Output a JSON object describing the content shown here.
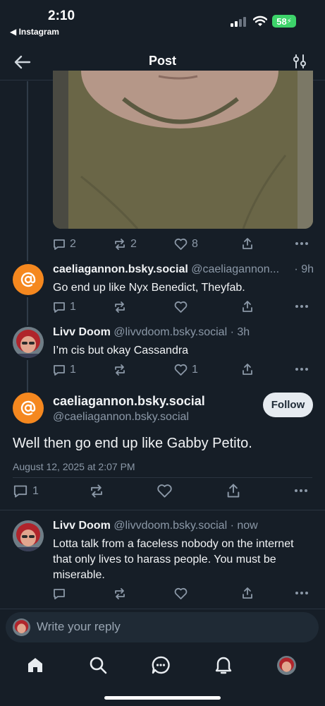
{
  "status": {
    "time": "2:10",
    "back_app": "◀ Instagram",
    "battery": "58"
  },
  "header": {
    "title": "Post"
  },
  "first_post": {
    "actions": {
      "replies": "2",
      "reposts": "2",
      "likes": "8"
    }
  },
  "reply1": {
    "name": "caeliagannon.bsky.social",
    "handle": "@caeliagannon...",
    "time": "· 9h",
    "text": "Go end up like Nyx Benedict, Theyfab.",
    "actions": {
      "replies": "1"
    }
  },
  "reply2": {
    "name": "Livv Doom",
    "handle": "@livvdoom.bsky.social",
    "time": "· 3h",
    "text": "I’m cis but okay Cassandra",
    "actions": {
      "replies": "1",
      "likes": "1"
    }
  },
  "main_post": {
    "name": "caeliagannon.bsky.social",
    "handle": "@caeliagannon.bsky.social",
    "follow_label": "Follow",
    "text": "Well then go end up like Gabby Petito.",
    "timestamp": "August 12, 2025 at 2:07 PM",
    "actions": {
      "replies": "1"
    }
  },
  "reply3": {
    "name": "Livv Doom",
    "handle": "@livvdoom.bsky.social",
    "time": "· now",
    "text": "Lotta talk from a faceless nobody on the internet that only lives to harass people. You must be miserable."
  },
  "composer": {
    "placeholder": "Write your reply"
  },
  "colors": {
    "accent_avatar": "#f5881f",
    "background": "#161e27",
    "battery": "#3dd36a"
  },
  "icons": [
    "back-arrow-icon",
    "tune-icon",
    "reply-icon",
    "repost-icon",
    "heart-icon",
    "share-icon",
    "more-icon",
    "home-icon",
    "search-icon",
    "chat-icon",
    "bell-icon"
  ]
}
